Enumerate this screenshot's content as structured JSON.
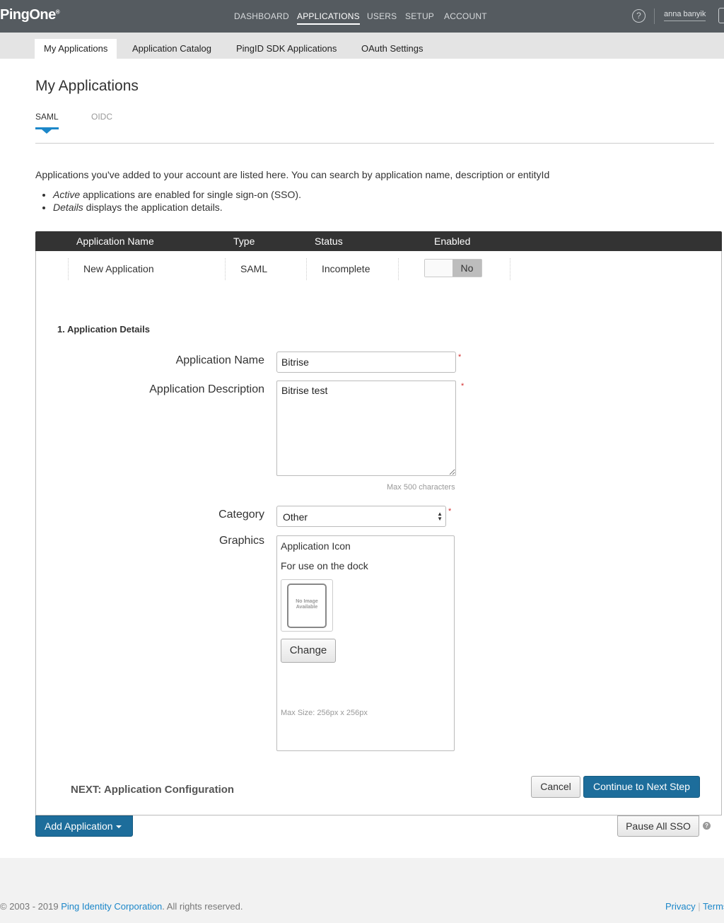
{
  "header": {
    "logo": "PingOne",
    "logo_mark": "®",
    "nav": [
      {
        "label": "DASHBOARD",
        "active": false
      },
      {
        "label": "APPLICATIONS",
        "active": true
      },
      {
        "label": "USERS",
        "active": false
      },
      {
        "label": "SETUP",
        "active": false
      },
      {
        "label": "ACCOUNT",
        "active": false
      }
    ],
    "help_icon": "?",
    "username": "anna banyik"
  },
  "subnav": {
    "tabs": [
      {
        "label": "My Applications",
        "active": true
      },
      {
        "label": "Application Catalog",
        "active": false
      },
      {
        "label": "PingID SDK Applications",
        "active": false
      },
      {
        "label": "OAuth Settings",
        "active": false
      }
    ]
  },
  "page": {
    "title": "My Applications",
    "type_tabs": [
      {
        "label": "SAML",
        "active": true
      },
      {
        "label": "OIDC",
        "active": false
      }
    ],
    "intro": "Applications you've added to your account are listed here. You can search by application name, description or entityId",
    "bullets": [
      {
        "em": "Active",
        "rest": " applications are enabled for single sign-on (SSO)."
      },
      {
        "em": "Details",
        "rest": " displays the application details."
      }
    ]
  },
  "table": {
    "headers": [
      "Application Name",
      "Type",
      "Status",
      "Enabled"
    ],
    "row": {
      "name": "New Application",
      "type": "SAML",
      "status": "Incomplete",
      "enabled_label": "No"
    }
  },
  "details": {
    "section_title": "1. Application Details",
    "app_name_label": "Application Name",
    "app_name_value": "Bitrise",
    "app_desc_label": "Application Description",
    "app_desc_value": "Bitrise test",
    "desc_hint": "Max 500 characters",
    "category_label": "Category",
    "category_value": "Other",
    "graphics_label": "Graphics",
    "graphics": {
      "title": "Application Icon",
      "subtitle": "For use on the dock",
      "placeholder": "No Image Available",
      "change_label": "Change",
      "max_size": "Max Size: 256px x 256px"
    },
    "required_mark": "*",
    "next_label": "NEXT: Application Configuration",
    "cancel_label": "Cancel",
    "continue_label": "Continue to Next Step"
  },
  "actions": {
    "add_label": "Add Application",
    "pause_label": "Pause All SSO",
    "pause_help": "?"
  },
  "footer": {
    "copyright_prefix": "© 2003 - 2019 ",
    "company": "Ping Identity Corporation",
    "copyright_suffix": ". All rights reserved.",
    "privacy": "Privacy",
    "separator": "|",
    "terms": "Terms"
  },
  "colors": {
    "topbar": "#555b60",
    "accent": "#1c87c9",
    "primary_button": "#1d6d9b",
    "required": "#d32f2f"
  }
}
